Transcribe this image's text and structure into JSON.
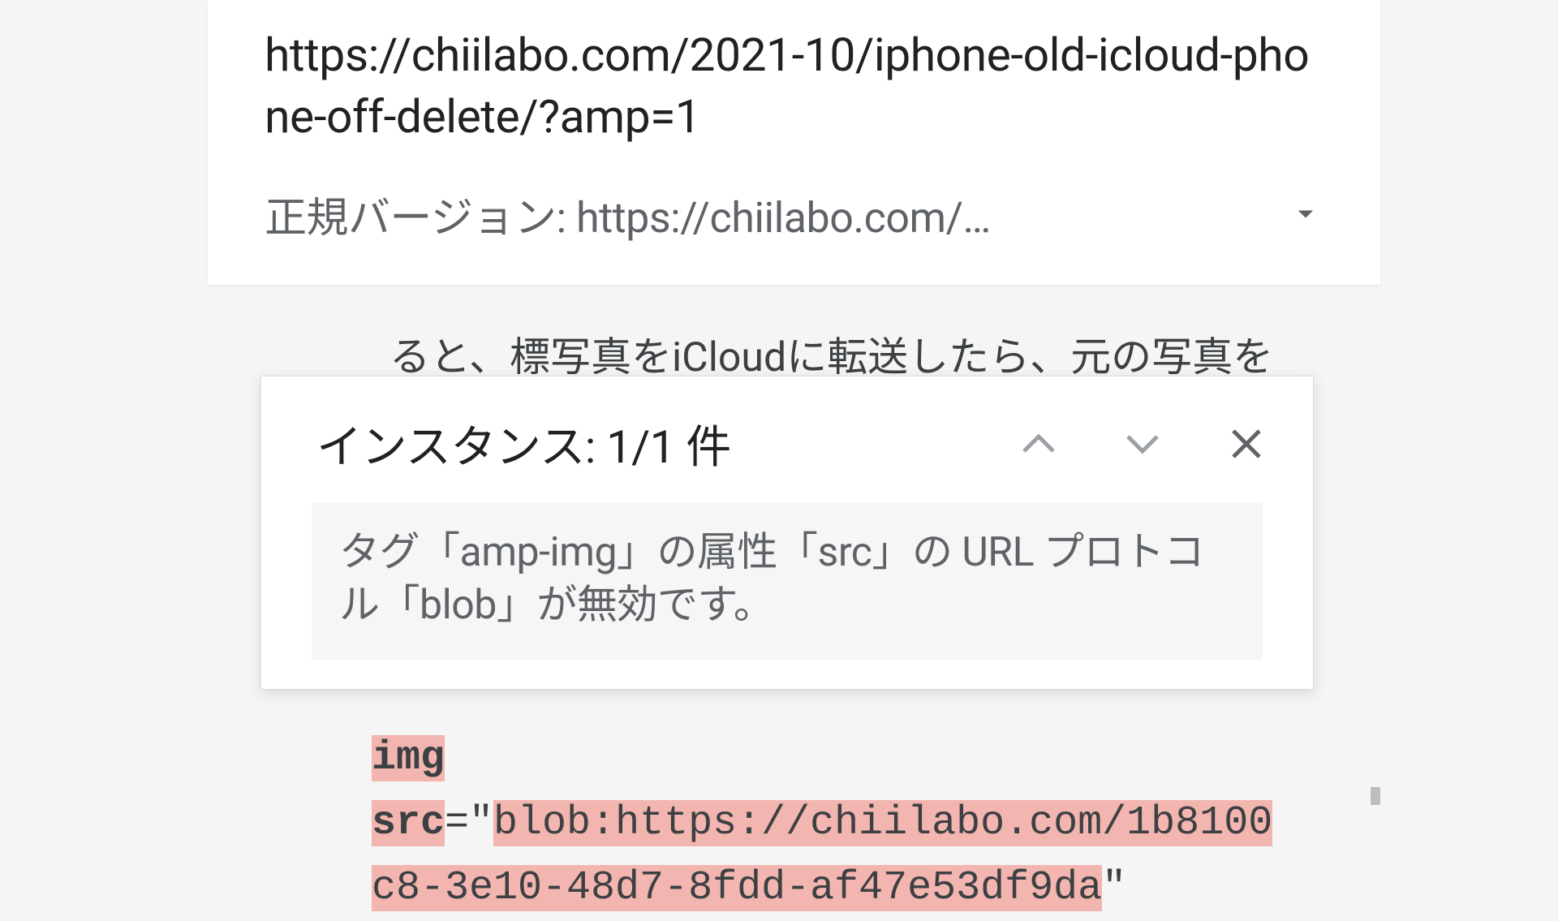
{
  "header": {
    "url": "https://chiilabo.com/2021-10/iphone-old-icloud-phone-off-delete/?amp=1",
    "canonical_label": "正規バージョン: https://chiilabo.com/…"
  },
  "behind_text": "ると、標写真をiCloudに転送したら、元の写真を",
  "popup": {
    "title": "インスタンス: 1/1 件",
    "message": "タグ「amp-img」の属性「src」の URL プロトコル「blob」が無効です。"
  },
  "code": {
    "tag": "img",
    "attr": "src",
    "eq": "=",
    "q1": "\"",
    "val_line1": "blob:https://chiilabo.com/1b8100",
    "val_line2": "c8-3e10-48d7-8fdd-af47e53df9da",
    "q2": "\""
  }
}
